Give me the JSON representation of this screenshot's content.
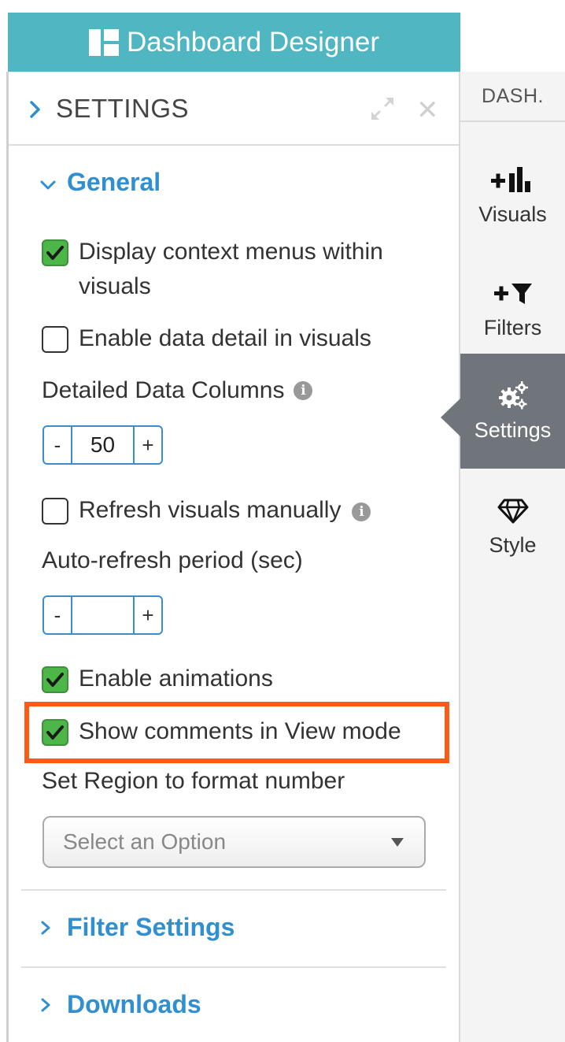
{
  "app": {
    "title": "Dashboard Designer",
    "logo_icon": "dashboard-grid-icon"
  },
  "panel": {
    "title": "SETTINGS",
    "sections": {
      "general": {
        "label": "General",
        "expanded": true,
        "options": {
          "context_menus": {
            "label": "Display context menus within visuals",
            "checked": true
          },
          "data_detail": {
            "label": "Enable data detail in visuals",
            "checked": false
          },
          "detailed_columns": {
            "label": "Detailed Data Columns",
            "minus": "-",
            "value": "50",
            "plus": "+"
          },
          "refresh_manual": {
            "label": "Refresh visuals manually",
            "checked": false
          },
          "auto_refresh": {
            "label": "Auto-refresh period (sec)",
            "minus": "-",
            "value": "",
            "plus": "+"
          },
          "animations": {
            "label": "Enable animations",
            "checked": true
          },
          "comments_view": {
            "label": "Show comments in View mode",
            "checked": true
          },
          "region_format": {
            "label": "Set Region to format number",
            "placeholder": "Select an Option"
          }
        }
      },
      "filter_settings": {
        "label": "Filter Settings",
        "expanded": false
      },
      "downloads": {
        "label": "Downloads",
        "expanded": false
      }
    }
  },
  "rail": {
    "dash_tab": "DASH.",
    "items": [
      {
        "label": "Visuals",
        "icon": "add-visual-icon",
        "active": false
      },
      {
        "label": "Filters",
        "icon": "add-filter-icon",
        "active": false
      },
      {
        "label": "Settings",
        "icon": "gears-icon",
        "active": true
      },
      {
        "label": "Style",
        "icon": "diamond-icon",
        "active": false
      }
    ]
  },
  "colors": {
    "title_bar": "#4fb6c2",
    "section_title": "#2f8fd0",
    "checkbox_checked": "#4cb748",
    "highlight_border": "#ff5a14",
    "rail_active": "#6f757a"
  }
}
